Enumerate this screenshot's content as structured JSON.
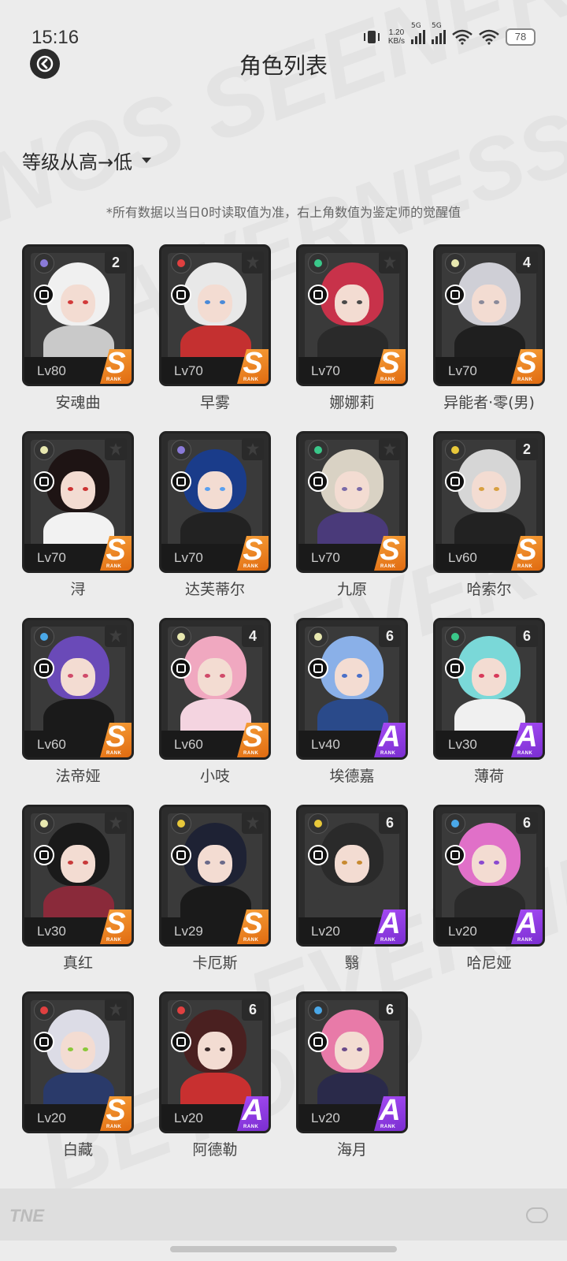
{
  "status": {
    "time": "15:16",
    "speed": "1.20",
    "speed_unit": "KB/s",
    "net1": "5G",
    "net2": "5G",
    "battery": "78"
  },
  "header": {
    "title": "角色列表"
  },
  "sort": {
    "label": "等级从高→低"
  },
  "note": "*所有数据以当日0时读取值为准，右上角数值为鉴定师的觉醒值",
  "rank_sub": "RANK",
  "colors": {
    "rank_S": "#f08a24",
    "rank_A": "#9a3ff0",
    "card_bg": "#2c2c2c",
    "page_bg": "#ececec"
  },
  "characters": [
    {
      "name": "安魂曲",
      "level": "Lv80",
      "rank": "S",
      "awaken": "2",
      "element": "moon",
      "role": "spiral",
      "hair": "#f0f0f0",
      "body": "#c9c9c9",
      "eye": "#d23a3a"
    },
    {
      "name": "早雾",
      "level": "Lv70",
      "rank": "S",
      "awaken": "",
      "element": "fire",
      "role": "vortex",
      "hair": "#e8e8e8",
      "body": "#c43030",
      "eye": "#4a8ad8"
    },
    {
      "name": "娜娜莉",
      "level": "Lv70",
      "rank": "S",
      "awaken": "",
      "element": "wind",
      "role": "bolt",
      "hair": "#c8324a",
      "body": "#2a2a2a",
      "eye": "#4a4a4a"
    },
    {
      "name": "异能者·零(男)",
      "level": "Lv70",
      "rank": "S",
      "awaken": "4",
      "element": "light",
      "role": "cube",
      "hair": "#cfcfd6",
      "body": "#1f1f1f",
      "eye": "#8a8a9a"
    },
    {
      "name": "浔",
      "level": "Lv70",
      "rank": "S",
      "awaken": "",
      "element": "light",
      "role": "cube",
      "hair": "#1e1414",
      "body": "#f2f2f2",
      "eye": "#c33"
    },
    {
      "name": "达芙蒂尔",
      "level": "Lv70",
      "rank": "S",
      "awaken": "",
      "element": "moon",
      "role": "spiral",
      "hair": "#1a3c8a",
      "body": "#222",
      "eye": "#5aa0f0"
    },
    {
      "name": "九原",
      "level": "Lv70",
      "rank": "S",
      "awaken": "",
      "element": "wind",
      "role": "cube",
      "hair": "#d9d2c4",
      "body": "#4a3a7a",
      "eye": "#7a6aa8"
    },
    {
      "name": "哈索尔",
      "level": "Lv60",
      "rank": "S",
      "awaken": "2",
      "element": "star",
      "role": "bolt",
      "hair": "#d6d6d6",
      "body": "#222",
      "eye": "#d8a040"
    },
    {
      "name": "法帝娅",
      "level": "Lv60",
      "rank": "S",
      "awaken": "",
      "element": "water",
      "role": "gear",
      "hair": "#6a4ab8",
      "body": "#1a1a1a",
      "eye": "#d04a6a"
    },
    {
      "name": "小吱",
      "level": "Lv60",
      "rank": "S",
      "awaken": "4",
      "element": "light",
      "role": "vortex",
      "hair": "#f0a8c0",
      "body": "#f4d4e0",
      "eye": "#d04a6a"
    },
    {
      "name": "埃德嘉",
      "level": "Lv40",
      "rank": "A",
      "awaken": "6",
      "element": "light",
      "role": "spiral",
      "hair": "#8ab0e8",
      "body": "#2a4a8a",
      "eye": "#4a70c8"
    },
    {
      "name": "薄荷",
      "level": "Lv30",
      "rank": "A",
      "awaken": "6",
      "element": "wind",
      "role": "spiral",
      "hair": "#7ad8d8",
      "body": "#f0f0f0",
      "eye": "#d83a5a"
    },
    {
      "name": "真红",
      "level": "Lv30",
      "rank": "S",
      "awaken": "",
      "element": "light",
      "role": "gear",
      "hair": "#1a1a1a",
      "body": "#8a2a3a",
      "eye": "#c83a3a"
    },
    {
      "name": "卡厄斯",
      "level": "Lv29",
      "rank": "S",
      "awaken": "",
      "element": "star",
      "role": "gear",
      "hair": "#1e2234",
      "body": "#1a1a1a",
      "eye": "#6a6a8a"
    },
    {
      "name": "翳",
      "level": "Lv20",
      "rank": "A",
      "awaken": "6",
      "element": "star",
      "role": "vortex",
      "hair": "#2a2a2a",
      "body": "#3a3a3a",
      "eye": "#c88a30"
    },
    {
      "name": "哈尼娅",
      "level": "Lv20",
      "rank": "A",
      "awaken": "6",
      "element": "water",
      "role": "gear",
      "hair": "#e070c8",
      "body": "#2a2a2a",
      "eye": "#8a4ad0"
    },
    {
      "name": "白藏",
      "level": "Lv20",
      "rank": "S",
      "awaken": "",
      "element": "fire",
      "role": "gear",
      "hair": "#dcdce6",
      "body": "#2a3a6a",
      "eye": "#8ac83a"
    },
    {
      "name": "阿德勒",
      "level": "Lv20",
      "rank": "A",
      "awaken": "6",
      "element": "fire",
      "role": "gear",
      "hair": "#4a2020",
      "body": "#c83030",
      "eye": "#3a2a2a"
    },
    {
      "name": "海月",
      "level": "Lv20",
      "rank": "A",
      "awaken": "6",
      "element": "water",
      "role": "bolt",
      "hair": "#e87aa8",
      "body": "#2a2a4a",
      "eye": "#6a4a8a"
    }
  ],
  "footer": {
    "logo": "TNE"
  }
}
